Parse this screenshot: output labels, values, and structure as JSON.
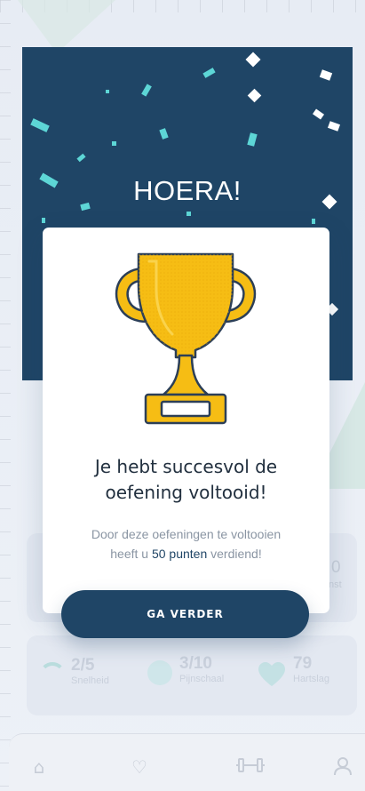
{
  "banner": {
    "title": "HOERA!"
  },
  "modal": {
    "heading_line1": "Je hebt succesvol de",
    "heading_line2": "oefening voltooid!",
    "text_line1": "Door deze oefeningen te voltooien",
    "text_prefix": "heeft u ",
    "text_highlight": "50 punten",
    "text_suffix": " verdiend!",
    "button_label": "GA VERDER"
  },
  "background": {
    "stat_top_right_value": "0",
    "stat_top_right_label": "nst",
    "stats": [
      {
        "value": "2/5",
        "label": "Snelheid"
      },
      {
        "value": "3/10",
        "label": "Pijnschaal"
      },
      {
        "value": "79",
        "label": "Hartslag"
      }
    ]
  },
  "colors": {
    "primary": "#1f4566",
    "confetti_cyan": "#5dd6d6",
    "trophy_gold": "#f6bd14",
    "trophy_outline": "#2c3f57"
  },
  "icons": [
    "trophy-icon",
    "home-icon",
    "heart-pulse-icon",
    "dumbbell-icon",
    "profile-icon"
  ]
}
